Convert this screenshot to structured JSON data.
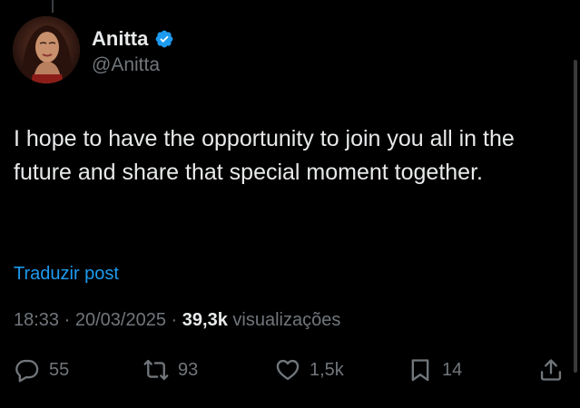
{
  "author": {
    "display_name": "Anitta",
    "handle": "@Anitta",
    "verified": true,
    "verified_color": "#1d9bf0"
  },
  "tweet": {
    "text": "I hope to have the opportunity to join you all in the future and share that special moment together.",
    "translate_label": "Traduzir post",
    "time": "18:33",
    "date": "20/03/2025",
    "separator": "·",
    "views_count": "39,3k",
    "views_label": "visualizações"
  },
  "actions": {
    "replies": "55",
    "reposts": "93",
    "likes": "1,5k",
    "bookmarks": "14"
  },
  "icons": {
    "reply": "reply-icon",
    "repost": "repost-icon",
    "like": "heart-icon",
    "bookmark": "bookmark-icon",
    "share": "share-icon",
    "verified": "verified-badge-icon"
  },
  "colors": {
    "background": "#000000",
    "text_primary": "#e7e9ea",
    "text_secondary": "#71767b",
    "link": "#1d9bf0"
  }
}
